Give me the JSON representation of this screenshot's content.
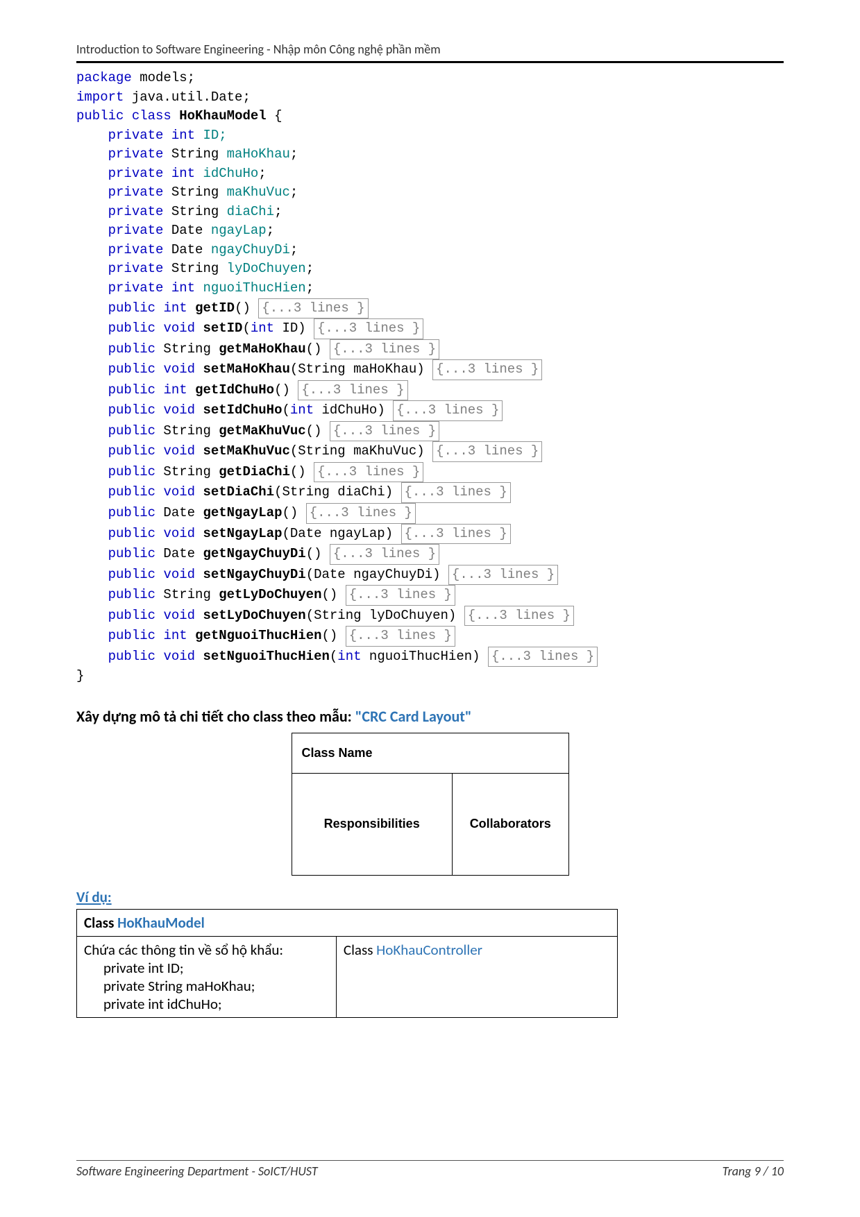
{
  "header": "Introduction to Software Engineering - Nhập môn Công nghệ phần mềm",
  "code": {
    "pkg": "package",
    "pkgName": " models;",
    "imp": "import",
    "impName": " java.util.Date;",
    "pub": "public",
    "cls": "class",
    "className": "HoKhauModel",
    "priv": "private",
    "int": "int",
    "str": "String",
    "date": "Date",
    "void": "void",
    "fields": {
      "id": "ID;",
      "maHoKhau": "maHoKhau",
      "idChuHo": "idChuHo",
      "maKhuVuc": "maKhuVuc",
      "diaChi": "diaChi",
      "ngayLap": "ngayLap",
      "ngayChuyDi": "ngayChuyDi",
      "lyDoChuyen": "lyDoChuyen",
      "nguoiThucHien": "nguoiThucHien"
    },
    "fold": "{...3 lines }",
    "methods": {
      "getID": "getID",
      "setID": "setID",
      "getMaHoKhau": "getMaHoKhau",
      "setMaHoKhau": "setMaHoKhau",
      "getIdChuHo": "getIdChuHo",
      "setIdChuHo": "setIdChuHo",
      "getMaKhuVuc": "getMaKhuVuc",
      "setMaKhuVuc": "setMaKhuVuc",
      "getDiaChi": "getDiaChi",
      "setDiaChi": "setDiaChi",
      "getNgayLap": "getNgayLap",
      "setNgayLap": "setNgayLap",
      "getNgayChuyDi": "getNgayChuyDi",
      "setNgayChuyDi": "setNgayChuyDi",
      "getLyDoChuyen": "getLyDoChuyen",
      "setLyDoChuyen": "setLyDoChuyen",
      "getNguoiThucHien": "getNguoiThucHien",
      "setNguoiThucHien": "setNguoiThucHien"
    }
  },
  "section": {
    "title_pre": "Xây dựng mô tả chi tiết cho class  theo mẫu: ",
    "title_link": "\"CRC Card Layout\""
  },
  "crc": {
    "className": "Class Name",
    "resp": "Responsibilities",
    "collab": "Collaborators"
  },
  "vidu": "Ví dụ:",
  "example": {
    "classLabel": "Class ",
    "className": "HoKhauModel",
    "respTitle": "Chứa các thông tin về sổ hộ khẩu:",
    "f1": "private int ID;",
    "f2": "private String maHoKhau;",
    "f3": "private int idChuHo;",
    "collabLabel": "Class ",
    "collabName": "HoKhauController"
  },
  "footer": {
    "left": "Software Engineering Department - SoICT/HUST",
    "right": "Trang 9 / 10"
  }
}
